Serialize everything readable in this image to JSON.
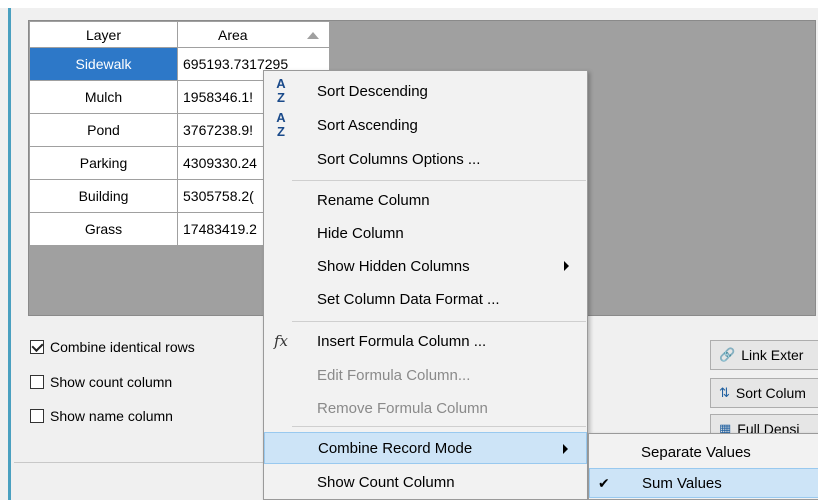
{
  "grid": {
    "columns": [
      "Layer",
      "Area"
    ],
    "sort_indicator": "ascending",
    "rows": [
      {
        "layer": "Sidewalk",
        "area": "695193.7317295",
        "selected": true
      },
      {
        "layer": "Mulch",
        "area": "1958346.1!"
      },
      {
        "layer": "Pond",
        "area": "3767238.9!"
      },
      {
        "layer": "Parking",
        "area": "4309330.24"
      },
      {
        "layer": "Building",
        "area": "5305758.2("
      },
      {
        "layer": "Grass",
        "area": "17483419.2"
      }
    ]
  },
  "options": {
    "combine_identical_rows": {
      "label": "Combine identical rows",
      "checked": true
    },
    "show_count_column": {
      "label": "Show count column",
      "checked": false
    },
    "show_name_column": {
      "label": "Show name column",
      "checked": false
    }
  },
  "side_buttons": {
    "link_external": "Link Exter",
    "sort_columns": "Sort Colum",
    "full_partial": "Full Densi"
  },
  "context_menu": {
    "sort_descending": "Sort Descending",
    "sort_ascending": "Sort Ascending",
    "sort_columns_options": "Sort Columns Options ...",
    "rename_column": "Rename Column",
    "hide_column": "Hide Column",
    "show_hidden_columns": "Show Hidden Columns",
    "set_column_data_format": "Set Column Data Format ...",
    "insert_formula_column": "Insert Formula Column ...",
    "edit_formula_column": "Edit Formula Column...",
    "remove_formula_column": "Remove Formula Column",
    "combine_record_mode": "Combine Record Mode",
    "show_count_column": "Show Count Column"
  },
  "submenu": {
    "separate_values": "Separate Values",
    "sum_values": "Sum Values",
    "checked_item": "Sum Values"
  },
  "icons": {
    "sort_desc_glyph": "A↑Z",
    "fx_glyph": "fx",
    "check_glyph": "✔"
  },
  "colors": {
    "selection": "#2d78c8",
    "menu_highlight": "#cde4f7",
    "accent": "#4aa0c0"
  }
}
